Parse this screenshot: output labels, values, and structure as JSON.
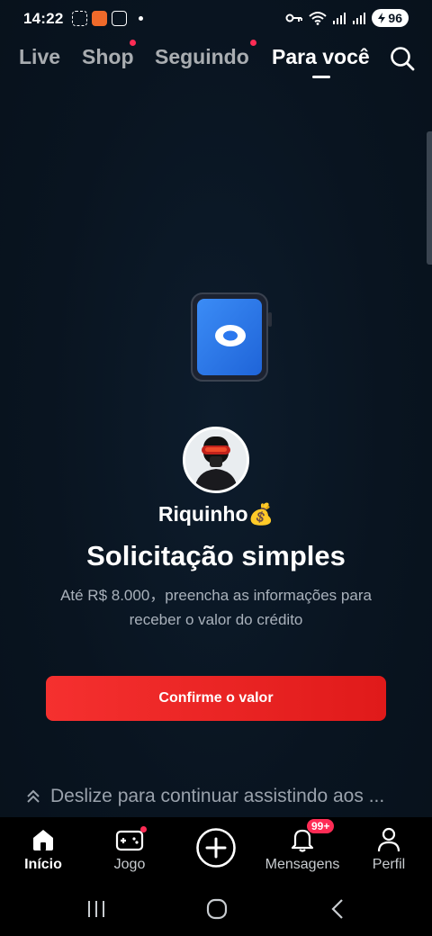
{
  "status_bar": {
    "time": "14:22",
    "battery": "96",
    "icons": [
      "screen-record-icon",
      "app-notification-icon",
      "screenshot-icon",
      "dot-icon",
      "vpn-key-icon",
      "wifi-icon",
      "signal-icon",
      "signal-icon",
      "battery-icon"
    ]
  },
  "top_nav": {
    "tabs": [
      {
        "label": "Live",
        "active": false,
        "dot": false
      },
      {
        "label": "Shop",
        "active": false,
        "dot": true
      },
      {
        "label": "Seguindo",
        "active": false,
        "dot": true
      },
      {
        "label": "Para você",
        "active": true,
        "dot": false
      }
    ],
    "search_icon": "search-icon"
  },
  "content": {
    "username": "Riquinho💰",
    "headline": "Solicitação simples",
    "subtext": "Até R$ 8.000，preencha as informações para receber o valor do crédito",
    "cta_label": "Confirme o valor",
    "swipe_hint": "Deslize para continuar assistindo aos ..."
  },
  "bottom_nav": {
    "items": [
      {
        "label": "Início",
        "icon": "home-icon",
        "active": true
      },
      {
        "label": "Jogo",
        "icon": "gamepad-icon",
        "active": false
      },
      {
        "label": "",
        "icon": "plus-icon",
        "active": false
      },
      {
        "label": "Mensagens",
        "icon": "bell-icon",
        "active": false,
        "badge": "99+"
      },
      {
        "label": "Perfil",
        "icon": "profile-icon",
        "active": false
      }
    ]
  },
  "colors": {
    "background": "#0a1522",
    "accent_red": "#fe2c55",
    "button_red": "#f5302f",
    "phone_blue": "#2f80f0"
  }
}
